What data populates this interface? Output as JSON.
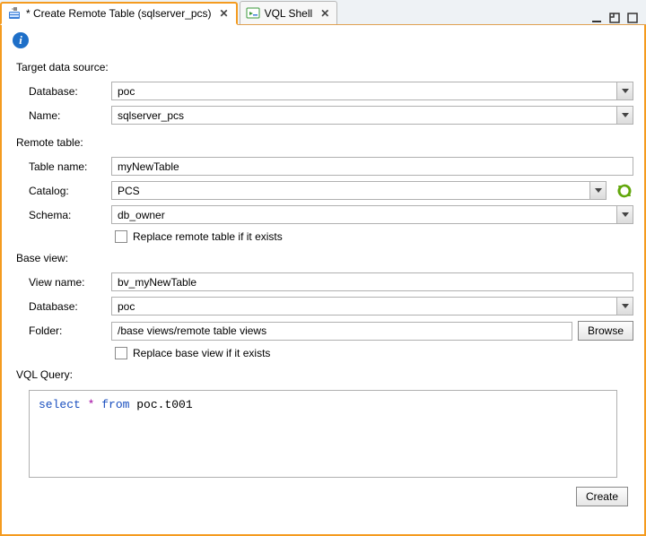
{
  "tabs": [
    {
      "label": "* Create Remote Table (sqlserver_pcs)",
      "active": true
    },
    {
      "label": "VQL Shell",
      "active": false
    }
  ],
  "sections": {
    "target": {
      "title": "Target data source:",
      "database_label": "Database:",
      "database_value": "poc",
      "name_label": "Name:",
      "name_value": "sqlserver_pcs"
    },
    "remote": {
      "title": "Remote table:",
      "tablename_label": "Table name:",
      "tablename_value": "myNewTable",
      "catalog_label": "Catalog:",
      "catalog_value": "PCS",
      "schema_label": "Schema:",
      "schema_value": "db_owner",
      "replace_label": "Replace remote table if it exists"
    },
    "baseview": {
      "title": "Base view:",
      "viewname_label": "View name:",
      "viewname_value": "bv_myNewTable",
      "database_label": "Database:",
      "database_value": "poc",
      "folder_label": "Folder:",
      "folder_value": "/base views/remote table views",
      "browse_label": "Browse",
      "replace_label": "Replace base view if it exists"
    },
    "vql": {
      "title": "VQL Query:",
      "query_kw_select": "select",
      "query_star": " * ",
      "query_kw_from": "from",
      "query_rest": " poc.t001"
    }
  },
  "footer": {
    "create_label": "Create"
  }
}
